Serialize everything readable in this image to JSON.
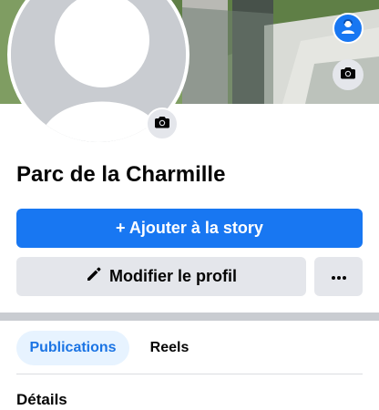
{
  "page": {
    "name": "Parc de la Charmille"
  },
  "actions": {
    "add_story_icon": "plus-icon",
    "add_story_label": "+ Ajouter à la story",
    "edit_profile_icon": "pencil-icon",
    "edit_profile_label": "Modifier le profil",
    "more_icon": "more-horizontal-icon"
  },
  "cover": {
    "avatar_icon": "avatar-icon",
    "camera_icon": "camera-icon"
  },
  "profile": {
    "camera_icon": "camera-icon"
  },
  "tabs": [
    {
      "label": "Publications",
      "active": true
    },
    {
      "label": "Reels",
      "active": false
    }
  ],
  "sections": {
    "details_title": "Détails"
  },
  "colors": {
    "primary": "#1877f2",
    "secondary_bg": "#e4e6eb",
    "active_tab_bg": "#e7f3ff",
    "active_tab_text": "#1b74e4",
    "separator": "#c9ccd1"
  }
}
